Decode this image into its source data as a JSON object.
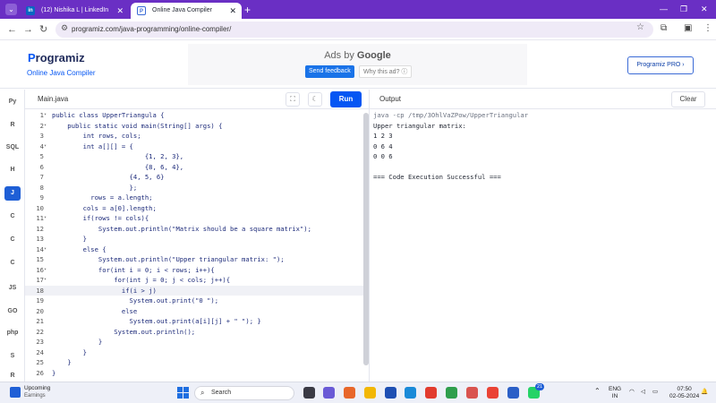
{
  "browser": {
    "tabs": [
      {
        "label": "(12) Nishika L | LinkedIn",
        "icon": "in"
      },
      {
        "label": "Online Java Compiler",
        "icon": "P"
      }
    ],
    "url": "programiz.com/java-programming/online-compiler/"
  },
  "header": {
    "logo_first": "P",
    "logo_rest": "rogramiz",
    "subtitle": "Online Java Compiler",
    "ad_prefix": "Ads by ",
    "ad_brand": "Google",
    "feedback": "Send feedback",
    "why_ad": "Why this ad? ⓘ",
    "pro": "Programiz PRO ›"
  },
  "rail": [
    "Py",
    "R",
    "SQL",
    "H",
    "J",
    "C",
    "C",
    "C",
    "JS",
    "GO",
    "php",
    "S",
    "R"
  ],
  "editor": {
    "file": "Main.java",
    "run": "Run",
    "lines": [
      {
        "n": "1",
        "f": "▾",
        "t": "public class UpperTriangula {"
      },
      {
        "n": "2",
        "f": "▾",
        "t": "    public static void main(String[] args) {"
      },
      {
        "n": "3",
        "f": "",
        "t": "        int rows, cols;"
      },
      {
        "n": "4",
        "f": "▾",
        "t": "        int a[][] = {"
      },
      {
        "n": "5",
        "f": "",
        "t": "                        {1, 2, 3},"
      },
      {
        "n": "6",
        "f": "",
        "t": "                        {8, 6, 4},"
      },
      {
        "n": "7",
        "f": "",
        "t": "                    {4, 5, 6}"
      },
      {
        "n": "8",
        "f": "",
        "t": "                    };"
      },
      {
        "n": "9",
        "f": "",
        "t": "          rows = a.length;"
      },
      {
        "n": "10",
        "f": "",
        "t": "        cols = a[0].length;"
      },
      {
        "n": "11",
        "f": "▾",
        "t": "        if(rows != cols){"
      },
      {
        "n": "12",
        "f": "",
        "t": "            System.out.println(\"Matrix should be a square matrix\");"
      },
      {
        "n": "13",
        "f": "",
        "t": "        }"
      },
      {
        "n": "14",
        "f": "▾",
        "t": "        else {"
      },
      {
        "n": "15",
        "f": "",
        "t": "            System.out.println(\"Upper triangular matrix: \");"
      },
      {
        "n": "16",
        "f": "▾",
        "t": "            for(int i = 0; i < rows; i++){"
      },
      {
        "n": "17",
        "f": "▾",
        "t": "                for(int j = 0; j < cols; j++){"
      },
      {
        "n": "18",
        "f": "",
        "t": "                  if(i > j)"
      },
      {
        "n": "19",
        "f": "",
        "t": "                    System.out.print(\"0 \");"
      },
      {
        "n": "20",
        "f": "",
        "t": "                  else"
      },
      {
        "n": "21",
        "f": "",
        "t": "                    System.out.print(a[i][j] + \" \"); }"
      },
      {
        "n": "22",
        "f": "",
        "t": "                System.out.println();"
      },
      {
        "n": "23",
        "f": "",
        "t": "            }"
      },
      {
        "n": "24",
        "f": "",
        "t": "        }"
      },
      {
        "n": "25",
        "f": "",
        "t": "    }"
      },
      {
        "n": "26",
        "f": "",
        "t": "}"
      }
    ]
  },
  "output": {
    "title": "Output",
    "clear": "Clear",
    "lines": [
      "java -cp /tmp/3OhlVaZPow/UpperTriangular",
      "Upper triangular matrix:",
      "1 2 3",
      "0 6 4",
      "0 0 6",
      "",
      "=== Code Execution Successful ==="
    ]
  },
  "taskbar": {
    "weather_title": "Upcoming",
    "weather_sub": "Earnings",
    "search": "Search",
    "lang1": "ENG",
    "lang2": "IN",
    "time": "07:50",
    "date": "02-05-2024",
    "badge": "21"
  },
  "colors": {
    "accent": "#0556f3",
    "chrome": "#6a2fc4"
  }
}
